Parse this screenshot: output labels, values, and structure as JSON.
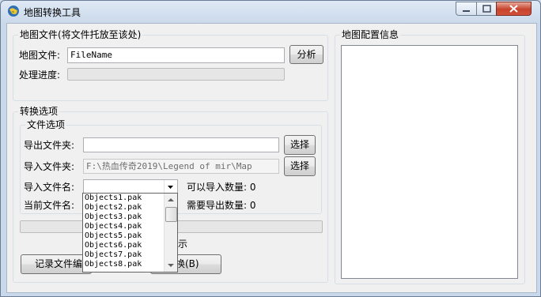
{
  "window": {
    "title": "地图转换工具"
  },
  "map_file_group": {
    "legend": "地图文件(将文件托放至该处)",
    "file_label": "地图文件:",
    "file_value": "FileName",
    "analyze_button": "分析",
    "progress_label": "处理进度:",
    "progress_value": 0
  },
  "map_config_group": {
    "legend": "地图配置信息"
  },
  "convert_group": {
    "legend": "转换选项",
    "file_options": {
      "legend": "文件选项",
      "export_folder_label": "导出文件夹:",
      "export_folder_value": "",
      "export_browse": "选择",
      "import_folder_label": "导入文件夹:",
      "import_folder_value": "F:\\热血传奇2019\\Legend of mir\\Map",
      "import_browse": "选择",
      "import_filename_label": "导入文件名:",
      "importable_count": "可以导入数量: 0",
      "current_filename_label": "当前文件名:",
      "export_needed_count": "需要导出数量: 0",
      "filename_options": [
        "Objects1.pak",
        "Objects2.pak",
        "Objects3.pak",
        "Objects4.pak",
        "Objects5.pak",
        "Objects6.pak",
        "Objects7.pak",
        "Objects8.pak"
      ]
    },
    "partial_label": "示",
    "record_button": "记录文件编",
    "convert_button": "换(B)"
  },
  "colors": {
    "accent": "#3399ff",
    "close_button": "#c6432c"
  }
}
